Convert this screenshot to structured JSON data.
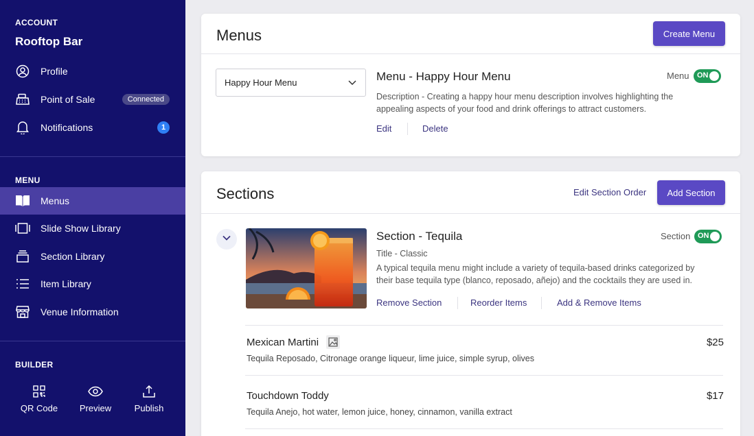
{
  "sidebar": {
    "account_label": "ACCOUNT",
    "account_name": "Rooftop Bar",
    "account_items": [
      {
        "label": "Profile",
        "icon": "user-circle-icon"
      },
      {
        "label": "Point of Sale",
        "icon": "cash-register-icon",
        "badge": "Connected"
      },
      {
        "label": "Notifications",
        "icon": "bell-icon",
        "count": "1"
      }
    ],
    "menu_label": "MENU",
    "menu_items": [
      {
        "label": "Menus",
        "icon": "book-icon",
        "active": true
      },
      {
        "label": "Slide Show Library",
        "icon": "slides-icon"
      },
      {
        "label": "Section Library",
        "icon": "layers-icon"
      },
      {
        "label": "Item Library",
        "icon": "list-icon"
      },
      {
        "label": "Venue Information",
        "icon": "storefront-icon"
      }
    ],
    "builder_label": "BUILDER",
    "builder_items": [
      {
        "label": "QR Code",
        "icon": "qr-code-icon"
      },
      {
        "label": "Preview",
        "icon": "eye-icon"
      },
      {
        "label": "Publish",
        "icon": "upload-icon"
      }
    ]
  },
  "menus_card": {
    "title": "Menus",
    "create_button": "Create Menu",
    "selected_menu": "Happy Hour Menu",
    "menu_title": "Menu - Happy Hour Menu",
    "toggle_label": "Menu",
    "toggle_state": "ON",
    "description": "Description - Creating a happy hour menu description involves highlighting the appealing aspects of your food and drink offerings to attract customers.",
    "edit_link": "Edit",
    "delete_link": "Delete"
  },
  "sections_card": {
    "title": "Sections",
    "edit_order_link": "Edit Section Order",
    "add_button": "Add Section",
    "section_title": "Section - Tequila",
    "section_subtitle": "Title - Classic",
    "toggle_label": "Section",
    "toggle_state": "ON",
    "description": "A typical tequila menu might include a variety of tequila-based drinks categorized by their base tequila type (blanco, reposado, añejo) and the cocktails they are used in.",
    "remove_link": "Remove Section",
    "reorder_link": "Reorder Items",
    "add_remove_link": "Add & Remove Items",
    "items": [
      {
        "name": "Mexican Martini",
        "desc": "Tequila Reposado, Citronage orange liqueur, lime juice, simple syrup, olives",
        "price": "$25",
        "has_image_icon": true
      },
      {
        "name": "Touchdown Toddy",
        "desc": "Tequila  Anejo, hot water, lemon juice, honey, cinnamon, vanilla extract",
        "price": "$17",
        "has_image_icon": false
      }
    ]
  },
  "colors": {
    "sidebar_bg": "#13116c",
    "sidebar_active": "#4a3fa3",
    "primary": "#5a49c4",
    "toggle_on": "#1f9a57",
    "badge_blue": "#2f7ff5"
  }
}
